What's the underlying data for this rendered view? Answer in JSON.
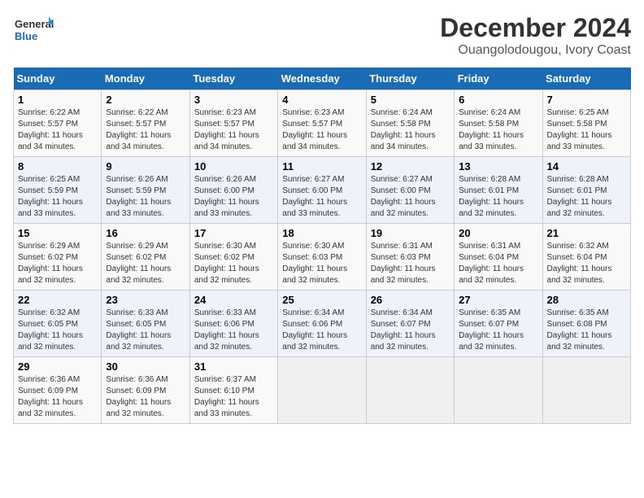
{
  "logo": {
    "line1": "General",
    "line2": "Blue"
  },
  "title": "December 2024",
  "location": "Ouangolodougou, Ivory Coast",
  "days_of_week": [
    "Sunday",
    "Monday",
    "Tuesday",
    "Wednesday",
    "Thursday",
    "Friday",
    "Saturday"
  ],
  "weeks": [
    [
      {
        "day": "1",
        "info": "Sunrise: 6:22 AM\nSunset: 5:57 PM\nDaylight: 11 hours\nand 34 minutes."
      },
      {
        "day": "2",
        "info": "Sunrise: 6:22 AM\nSunset: 5:57 PM\nDaylight: 11 hours\nand 34 minutes."
      },
      {
        "day": "3",
        "info": "Sunrise: 6:23 AM\nSunset: 5:57 PM\nDaylight: 11 hours\nand 34 minutes."
      },
      {
        "day": "4",
        "info": "Sunrise: 6:23 AM\nSunset: 5:57 PM\nDaylight: 11 hours\nand 34 minutes."
      },
      {
        "day": "5",
        "info": "Sunrise: 6:24 AM\nSunset: 5:58 PM\nDaylight: 11 hours\nand 34 minutes."
      },
      {
        "day": "6",
        "info": "Sunrise: 6:24 AM\nSunset: 5:58 PM\nDaylight: 11 hours\nand 33 minutes."
      },
      {
        "day": "7",
        "info": "Sunrise: 6:25 AM\nSunset: 5:58 PM\nDaylight: 11 hours\nand 33 minutes."
      }
    ],
    [
      {
        "day": "8",
        "info": "Sunrise: 6:25 AM\nSunset: 5:59 PM\nDaylight: 11 hours\nand 33 minutes."
      },
      {
        "day": "9",
        "info": "Sunrise: 6:26 AM\nSunset: 5:59 PM\nDaylight: 11 hours\nand 33 minutes."
      },
      {
        "day": "10",
        "info": "Sunrise: 6:26 AM\nSunset: 6:00 PM\nDaylight: 11 hours\nand 33 minutes."
      },
      {
        "day": "11",
        "info": "Sunrise: 6:27 AM\nSunset: 6:00 PM\nDaylight: 11 hours\nand 33 minutes."
      },
      {
        "day": "12",
        "info": "Sunrise: 6:27 AM\nSunset: 6:00 PM\nDaylight: 11 hours\nand 32 minutes."
      },
      {
        "day": "13",
        "info": "Sunrise: 6:28 AM\nSunset: 6:01 PM\nDaylight: 11 hours\nand 32 minutes."
      },
      {
        "day": "14",
        "info": "Sunrise: 6:28 AM\nSunset: 6:01 PM\nDaylight: 11 hours\nand 32 minutes."
      }
    ],
    [
      {
        "day": "15",
        "info": "Sunrise: 6:29 AM\nSunset: 6:02 PM\nDaylight: 11 hours\nand 32 minutes."
      },
      {
        "day": "16",
        "info": "Sunrise: 6:29 AM\nSunset: 6:02 PM\nDaylight: 11 hours\nand 32 minutes."
      },
      {
        "day": "17",
        "info": "Sunrise: 6:30 AM\nSunset: 6:02 PM\nDaylight: 11 hours\nand 32 minutes."
      },
      {
        "day": "18",
        "info": "Sunrise: 6:30 AM\nSunset: 6:03 PM\nDaylight: 11 hours\nand 32 minutes."
      },
      {
        "day": "19",
        "info": "Sunrise: 6:31 AM\nSunset: 6:03 PM\nDaylight: 11 hours\nand 32 minutes."
      },
      {
        "day": "20",
        "info": "Sunrise: 6:31 AM\nSunset: 6:04 PM\nDaylight: 11 hours\nand 32 minutes."
      },
      {
        "day": "21",
        "info": "Sunrise: 6:32 AM\nSunset: 6:04 PM\nDaylight: 11 hours\nand 32 minutes."
      }
    ],
    [
      {
        "day": "22",
        "info": "Sunrise: 6:32 AM\nSunset: 6:05 PM\nDaylight: 11 hours\nand 32 minutes."
      },
      {
        "day": "23",
        "info": "Sunrise: 6:33 AM\nSunset: 6:05 PM\nDaylight: 11 hours\nand 32 minutes."
      },
      {
        "day": "24",
        "info": "Sunrise: 6:33 AM\nSunset: 6:06 PM\nDaylight: 11 hours\nand 32 minutes."
      },
      {
        "day": "25",
        "info": "Sunrise: 6:34 AM\nSunset: 6:06 PM\nDaylight: 11 hours\nand 32 minutes."
      },
      {
        "day": "26",
        "info": "Sunrise: 6:34 AM\nSunset: 6:07 PM\nDaylight: 11 hours\nand 32 minutes."
      },
      {
        "day": "27",
        "info": "Sunrise: 6:35 AM\nSunset: 6:07 PM\nDaylight: 11 hours\nand 32 minutes."
      },
      {
        "day": "28",
        "info": "Sunrise: 6:35 AM\nSunset: 6:08 PM\nDaylight: 11 hours\nand 32 minutes."
      }
    ],
    [
      {
        "day": "29",
        "info": "Sunrise: 6:36 AM\nSunset: 6:09 PM\nDaylight: 11 hours\nand 32 minutes."
      },
      {
        "day": "30",
        "info": "Sunrise: 6:36 AM\nSunset: 6:09 PM\nDaylight: 11 hours\nand 32 minutes."
      },
      {
        "day": "31",
        "info": "Sunrise: 6:37 AM\nSunset: 6:10 PM\nDaylight: 11 hours\nand 33 minutes."
      },
      {
        "day": "",
        "info": ""
      },
      {
        "day": "",
        "info": ""
      },
      {
        "day": "",
        "info": ""
      },
      {
        "day": "",
        "info": ""
      }
    ]
  ]
}
